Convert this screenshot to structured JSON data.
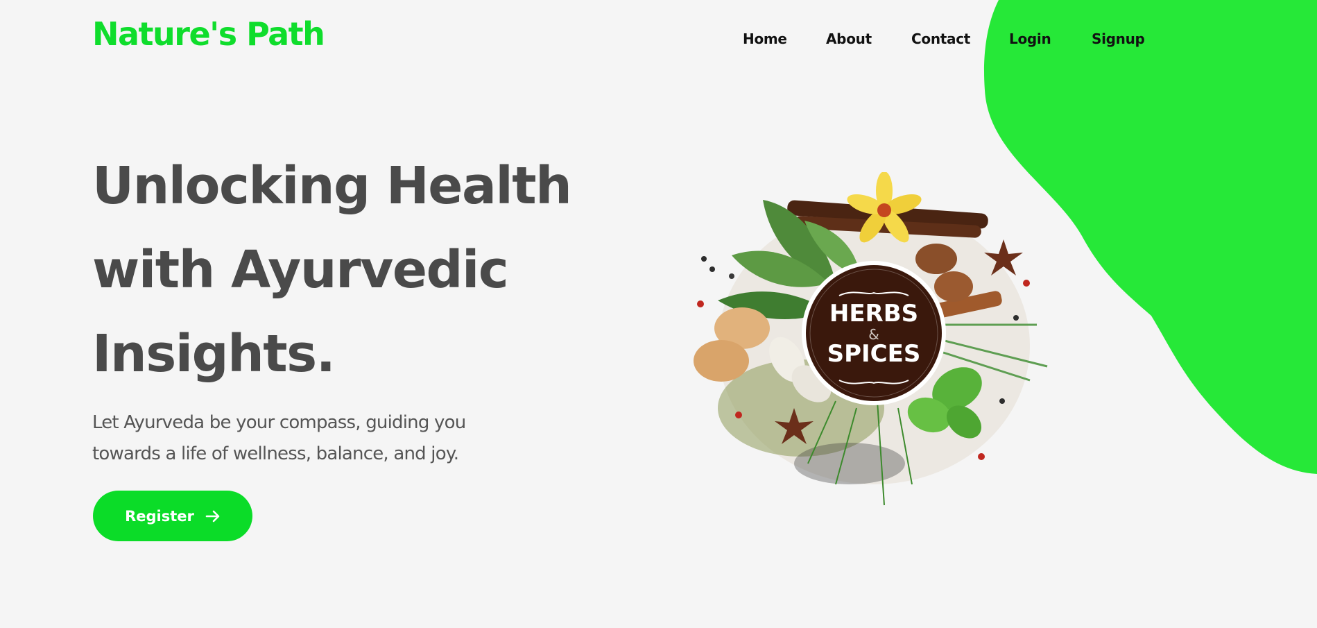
{
  "brand": {
    "name": "Nature's Path",
    "color": "#0fdd2c"
  },
  "nav": {
    "items": [
      "Home",
      "About",
      "Contact",
      "Login",
      "Signup"
    ]
  },
  "hero": {
    "title_lines": [
      "Unlocking Health",
      "with Ayurvedic",
      "Insights."
    ],
    "subtitle_lines": [
      "Let Ayurveda be your compass, guiding you",
      "towards a life of wellness, balance, and joy."
    ],
    "cta_label": "Register",
    "cta_icon": "arrow-right-icon"
  },
  "illustration": {
    "badge_line1": "HERBS",
    "badge_amp": "&",
    "badge_line2": "SPICES"
  },
  "colors": {
    "accent": "#0bdc28",
    "blob": "#26e838",
    "badge": "#3a180c"
  }
}
